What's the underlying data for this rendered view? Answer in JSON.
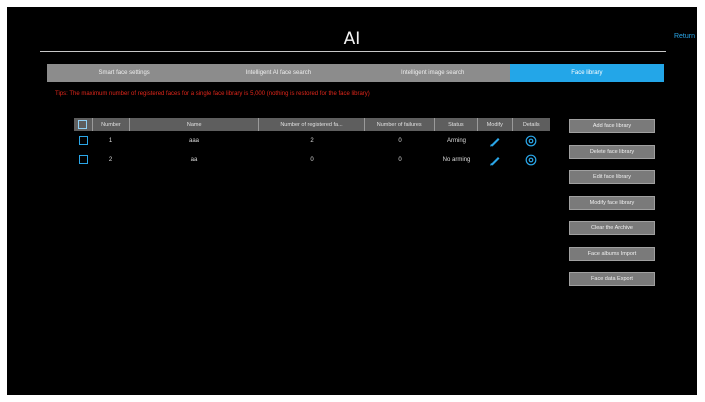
{
  "title": "AI",
  "return_label": "Return",
  "tabs": [
    {
      "label": "Smart face settings",
      "active": false
    },
    {
      "label": "Intelligent AI face search",
      "active": false
    },
    {
      "label": "Intelligent image search",
      "active": false
    },
    {
      "label": "Face library",
      "active": true
    }
  ],
  "warning": "Tips: The maximum number of registered faces for a single face library is 5,000 (nothing is restored for the face library)",
  "table": {
    "headers": [
      "Number",
      "Name",
      "Number of registered fa...",
      "Number of failures",
      "Status",
      "Modify",
      "Details"
    ],
    "rows": [
      {
        "number": "1",
        "name": "aaa",
        "registered": "2",
        "failures": "0",
        "status": "Arming"
      },
      {
        "number": "2",
        "name": "aa",
        "registered": "0",
        "failures": "0",
        "status": "No arming"
      }
    ]
  },
  "buttons": [
    "Add face library",
    "Delete face library",
    "Edit face library",
    "Modify face library",
    "Clear the Archive",
    "Face albums Import",
    "Face data Export"
  ],
  "colors": {
    "accent": "#23a6e8",
    "warning": "#e0261b",
    "background": "#000000"
  }
}
